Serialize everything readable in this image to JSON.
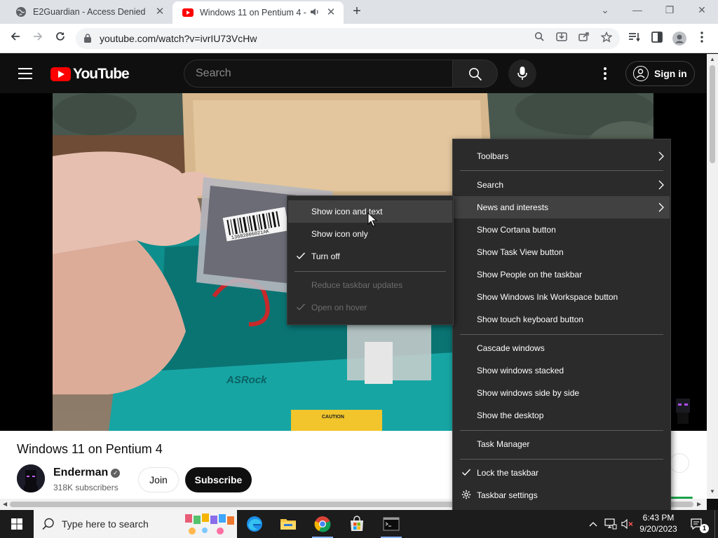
{
  "browser": {
    "tabs": [
      {
        "title": "E2Guardian - Access Denied",
        "active": false
      },
      {
        "title": "Windows 11 on Pentium 4 -",
        "active": true
      }
    ],
    "url": "youtube.com/watch?v=ivrIU73VcHw"
  },
  "youtube": {
    "logo_text": "YouTube",
    "search_placeholder": "Search",
    "sign_in_label": "Sign in",
    "video_title": "Windows 11 on Pentium 4",
    "channel_name": "Enderman",
    "subscribers": "318K subscribers",
    "join_label": "Join",
    "subscribe_label": "Subscribe"
  },
  "video_frame": {
    "box_brand": "ASRock",
    "barcode_number": "13602006021AK",
    "caution_label": "CAUTION"
  },
  "taskbar_menu": {
    "items": [
      {
        "label": "Toolbars",
        "submenu": true
      },
      {
        "label": "Search",
        "submenu": true
      },
      {
        "label": "News and interests",
        "submenu": true,
        "highlighted": true
      },
      {
        "label": "Show Cortana button"
      },
      {
        "label": "Show Task View button"
      },
      {
        "label": "Show People on the taskbar"
      },
      {
        "label": "Show Windows Ink Workspace button"
      },
      {
        "label": "Show touch keyboard button"
      },
      {
        "label": "Cascade windows"
      },
      {
        "label": "Show windows stacked"
      },
      {
        "label": "Show windows side by side"
      },
      {
        "label": "Show the desktop"
      },
      {
        "label": "Task Manager"
      },
      {
        "label": "Lock the taskbar",
        "checked": true
      },
      {
        "label": "Taskbar settings",
        "icon": "gear-icon"
      }
    ]
  },
  "news_submenu": {
    "items": [
      {
        "label": "Show icon and text",
        "highlighted": true
      },
      {
        "label": "Show icon only"
      },
      {
        "label": "Turn off",
        "checked": true
      },
      {
        "label": "Reduce taskbar updates",
        "disabled": true
      },
      {
        "label": "Open on hover",
        "disabled": true,
        "checked": true
      }
    ]
  },
  "taskbar": {
    "search_placeholder": "Type here to search",
    "pinned": [
      "edge-icon",
      "file-explorer-icon",
      "chrome-icon",
      "store-icon",
      "terminal-icon"
    ],
    "time": "6:43 PM",
    "date": "9/20/2023",
    "notification_count": "1"
  },
  "colors": {
    "youtube_red": "#ff0000",
    "menu_bg": "#2b2b2b",
    "menu_hover": "#414141",
    "taskbar_bg": "#1c1c1c"
  }
}
